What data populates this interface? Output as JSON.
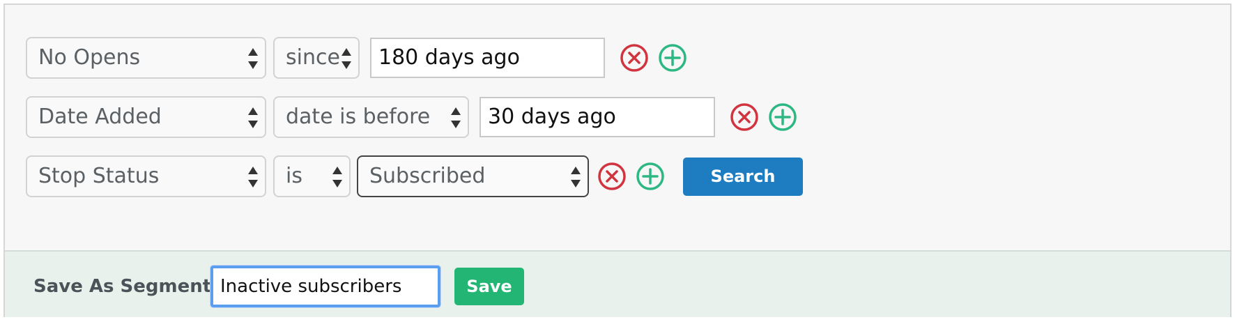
{
  "rules": [
    {
      "field": "No Opens",
      "operator": "since",
      "value": "180 days ago"
    },
    {
      "field": "Date Added",
      "operator": "date is before",
      "value": "30 days ago"
    },
    {
      "field": "Stop Status",
      "operator": "is",
      "value": "Subscribed"
    }
  ],
  "search_label": "Search",
  "segment": {
    "label": "Save As Segment:",
    "name_value": "Inactive subscribers",
    "save_label": "Save"
  },
  "icons": {
    "remove": "remove-circle-x-icon",
    "add": "add-circle-plus-icon"
  },
  "colors": {
    "remove": "#d1343e",
    "add": "#2db783",
    "search_button": "#1e7cc1",
    "save_button": "#22b573",
    "footer_background": "#e8f1ec"
  }
}
